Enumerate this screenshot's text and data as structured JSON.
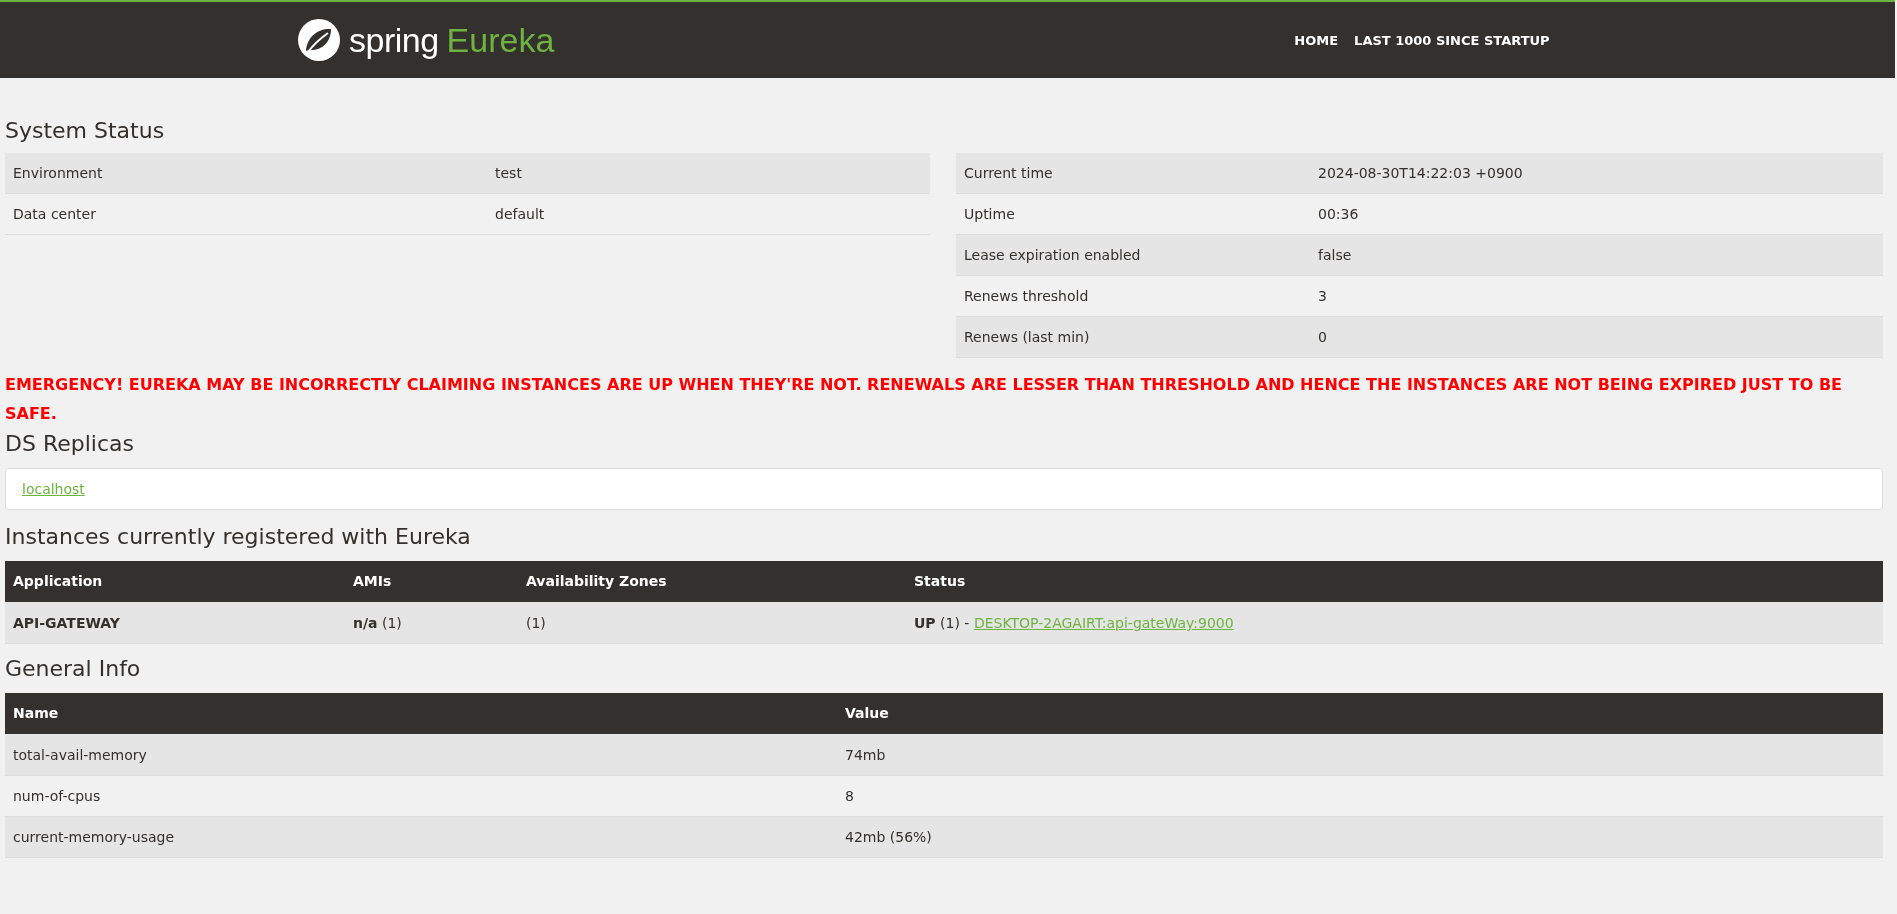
{
  "header": {
    "logo": {
      "brand": "spring",
      "product": "Eureka"
    },
    "nav": [
      {
        "label": "HOME"
      },
      {
        "label": "LAST 1000 SINCE STARTUP"
      }
    ]
  },
  "system_status": {
    "title": "System Status",
    "left": [
      {
        "name": "Environment",
        "value": "test"
      },
      {
        "name": "Data center",
        "value": "default"
      }
    ],
    "right": [
      {
        "name": "Current time",
        "value": "2024-08-30T14:22:03 +0900"
      },
      {
        "name": "Uptime",
        "value": "00:36"
      },
      {
        "name": "Lease expiration enabled",
        "value": "false"
      },
      {
        "name": "Renews threshold",
        "value": "3"
      },
      {
        "name": "Renews (last min)",
        "value": "0"
      }
    ]
  },
  "emergency": "EMERGENCY! EUREKA MAY BE INCORRECTLY CLAIMING INSTANCES ARE UP WHEN THEY'RE NOT. RENEWALS ARE LESSER THAN THRESHOLD AND HENCE THE INSTANCES ARE NOT BEING EXPIRED JUST TO BE SAFE.",
  "ds_replicas": {
    "title": "DS Replicas",
    "replicas": [
      "localhost"
    ]
  },
  "instances": {
    "title": "Instances currently registered with Eureka",
    "columns": [
      "Application",
      "AMIs",
      "Availability Zones",
      "Status"
    ],
    "rows": [
      {
        "application": "API-GATEWAY",
        "amis": "**n/a** (1)",
        "zones": "(1)",
        "status": "**UP** (1) -",
        "instance_link": "DESKTOP-2AGAIRT:api-gateWay:9000"
      }
    ]
  },
  "general_info": {
    "title": "General Info",
    "columns": [
      "Name",
      "Value"
    ],
    "rows": [
      {
        "name": "total-avail-memory",
        "value": "74mb"
      },
      {
        "name": "num-of-cpus",
        "value": "8"
      },
      {
        "name": "current-memory-usage",
        "value": "42mb (56%)"
      }
    ]
  }
}
